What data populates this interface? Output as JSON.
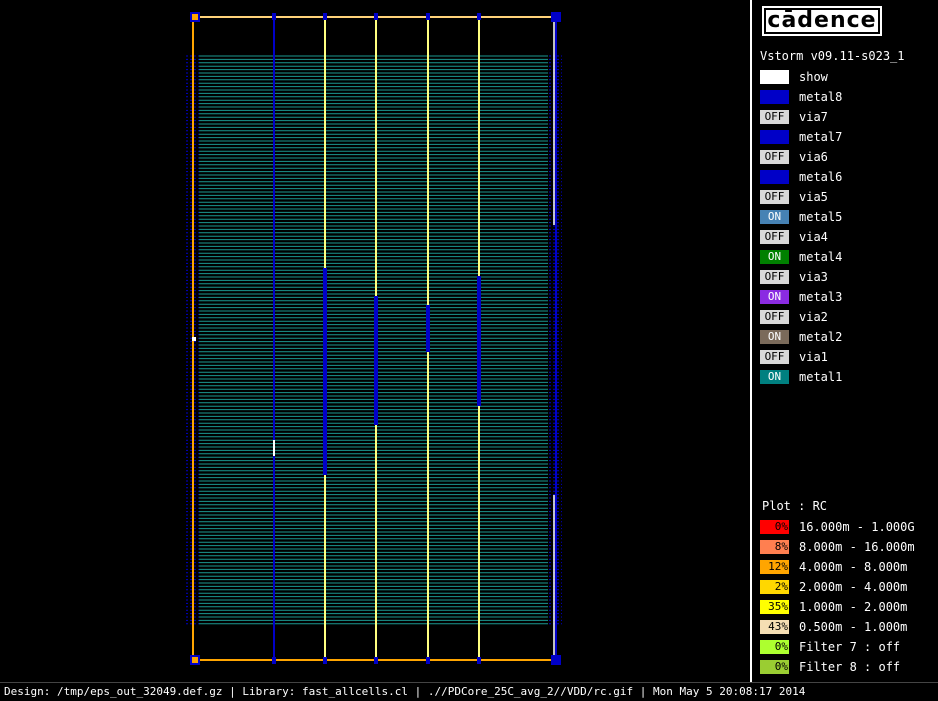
{
  "side_panel": {
    "logo_text": "cādence",
    "version": "Vstorm v09.11-s023_1",
    "layers": [
      {
        "state": "",
        "name": "show",
        "color": "#ffffff",
        "text_color": "#000000"
      },
      {
        "state": "ON",
        "name": "metal8",
        "color": "#0000c8",
        "text_color": "#0000c8"
      },
      {
        "state": "OFF",
        "name": "via7",
        "color": "#d8d8d8",
        "text_color": "#000000"
      },
      {
        "state": "ON",
        "name": "metal7",
        "color": "#0000c8",
        "text_color": "#0000c8"
      },
      {
        "state": "OFF",
        "name": "via6",
        "color": "#d8d8d8",
        "text_color": "#000000"
      },
      {
        "state": "ON",
        "name": "metal6",
        "color": "#0000c8",
        "text_color": "#0000c8"
      },
      {
        "state": "OFF",
        "name": "via5",
        "color": "#d8d8d8",
        "text_color": "#000000"
      },
      {
        "state": "ON",
        "name": "metal5",
        "color": "#4682b4",
        "text_color": "#ffffff"
      },
      {
        "state": "OFF",
        "name": "via4",
        "color": "#d8d8d8",
        "text_color": "#000000"
      },
      {
        "state": "ON",
        "name": "metal4",
        "color": "#008000",
        "text_color": "#ffffff"
      },
      {
        "state": "OFF",
        "name": "via3",
        "color": "#d8d8d8",
        "text_color": "#000000"
      },
      {
        "state": "ON",
        "name": "metal3",
        "color": "#8a2be2",
        "text_color": "#ffffff"
      },
      {
        "state": "OFF",
        "name": "via2",
        "color": "#d8d8d8",
        "text_color": "#000000"
      },
      {
        "state": "ON",
        "name": "metal2",
        "color": "#7a6a5a",
        "text_color": "#ffffff"
      },
      {
        "state": "OFF",
        "name": "via1",
        "color": "#d8d8d8",
        "text_color": "#000000"
      },
      {
        "state": "ON",
        "name": "metal1",
        "color": "#008080",
        "text_color": "#ffffff"
      }
    ],
    "plot_title": "Plot : RC",
    "legend": [
      {
        "pct": "0%",
        "range": "16.000m - 1.000G",
        "color": "#ff0000"
      },
      {
        "pct": "8%",
        "range": "8.000m - 16.000m",
        "color": "#ff7f50"
      },
      {
        "pct": "12%",
        "range": "4.000m - 8.000m",
        "color": "#ffa500"
      },
      {
        "pct": "2%",
        "range": "2.000m - 4.000m",
        "color": "#ffd700"
      },
      {
        "pct": "35%",
        "range": "1.000m - 2.000m",
        "color": "#ffff00"
      },
      {
        "pct": "43%",
        "range": "0.500m - 1.000m",
        "color": "#f5deb3"
      },
      {
        "pct": "0%",
        "range": "Filter 7 : off",
        "color": "#adff2f"
      },
      {
        "pct": "0%",
        "range": "Filter 8 : off",
        "color": "#9acd32"
      }
    ]
  },
  "status_bar": {
    "text": "Design: /tmp/eps_out_32049.def.gz | Library: fast_allcells.cl | .//PDCore_25C_avg_2//VDD/rc.gif | Mon May  5 20:08:17 2014"
  },
  "colors": {
    "row_lines": "#20b2aa",
    "vertical_blue": "#0000c8",
    "vertical_yellow": "#ffff80",
    "border_orange": "#ffa500"
  }
}
